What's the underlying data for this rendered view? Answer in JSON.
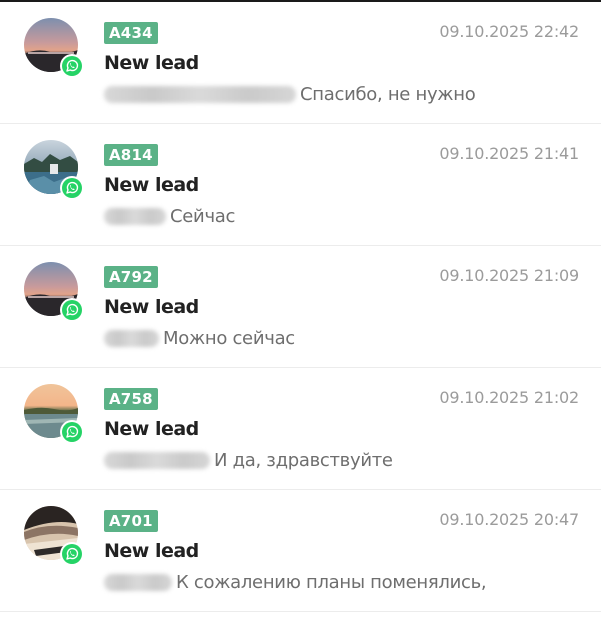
{
  "conversations": [
    {
      "tag": "A434",
      "title": "New lead",
      "date": "09.10.2025 22:42",
      "message": "Спасибо, не нужно",
      "channel_icon": "whatsapp-icon",
      "avatar": "sunset-landscape"
    },
    {
      "tag": "A814",
      "title": "New lead",
      "date": "09.10.2025 21:41",
      "message": "Сейчас",
      "channel_icon": "whatsapp-icon",
      "avatar": "lake-landscape"
    },
    {
      "tag": "A792",
      "title": "New lead",
      "date": "09.10.2025 21:09",
      "message": "Можно сейчас",
      "channel_icon": "whatsapp-icon",
      "avatar": "sunset-landscape"
    },
    {
      "tag": "A758",
      "title": "New lead",
      "date": "09.10.2025 21:02",
      "message": "И да, здравствуйте",
      "channel_icon": "whatsapp-icon",
      "avatar": "river-landscape"
    },
    {
      "tag": "A701",
      "title": "New lead",
      "date": "09.10.2025 20:47",
      "message": "К сожалению планы поменялись,",
      "channel_icon": "whatsapp-icon",
      "avatar": "dark-photo"
    }
  ],
  "colors": {
    "tag_background": "#5bb287",
    "whatsapp_green": "#25d366",
    "date_text": "#9b9b9b",
    "preview_text": "#6e6e6e"
  }
}
